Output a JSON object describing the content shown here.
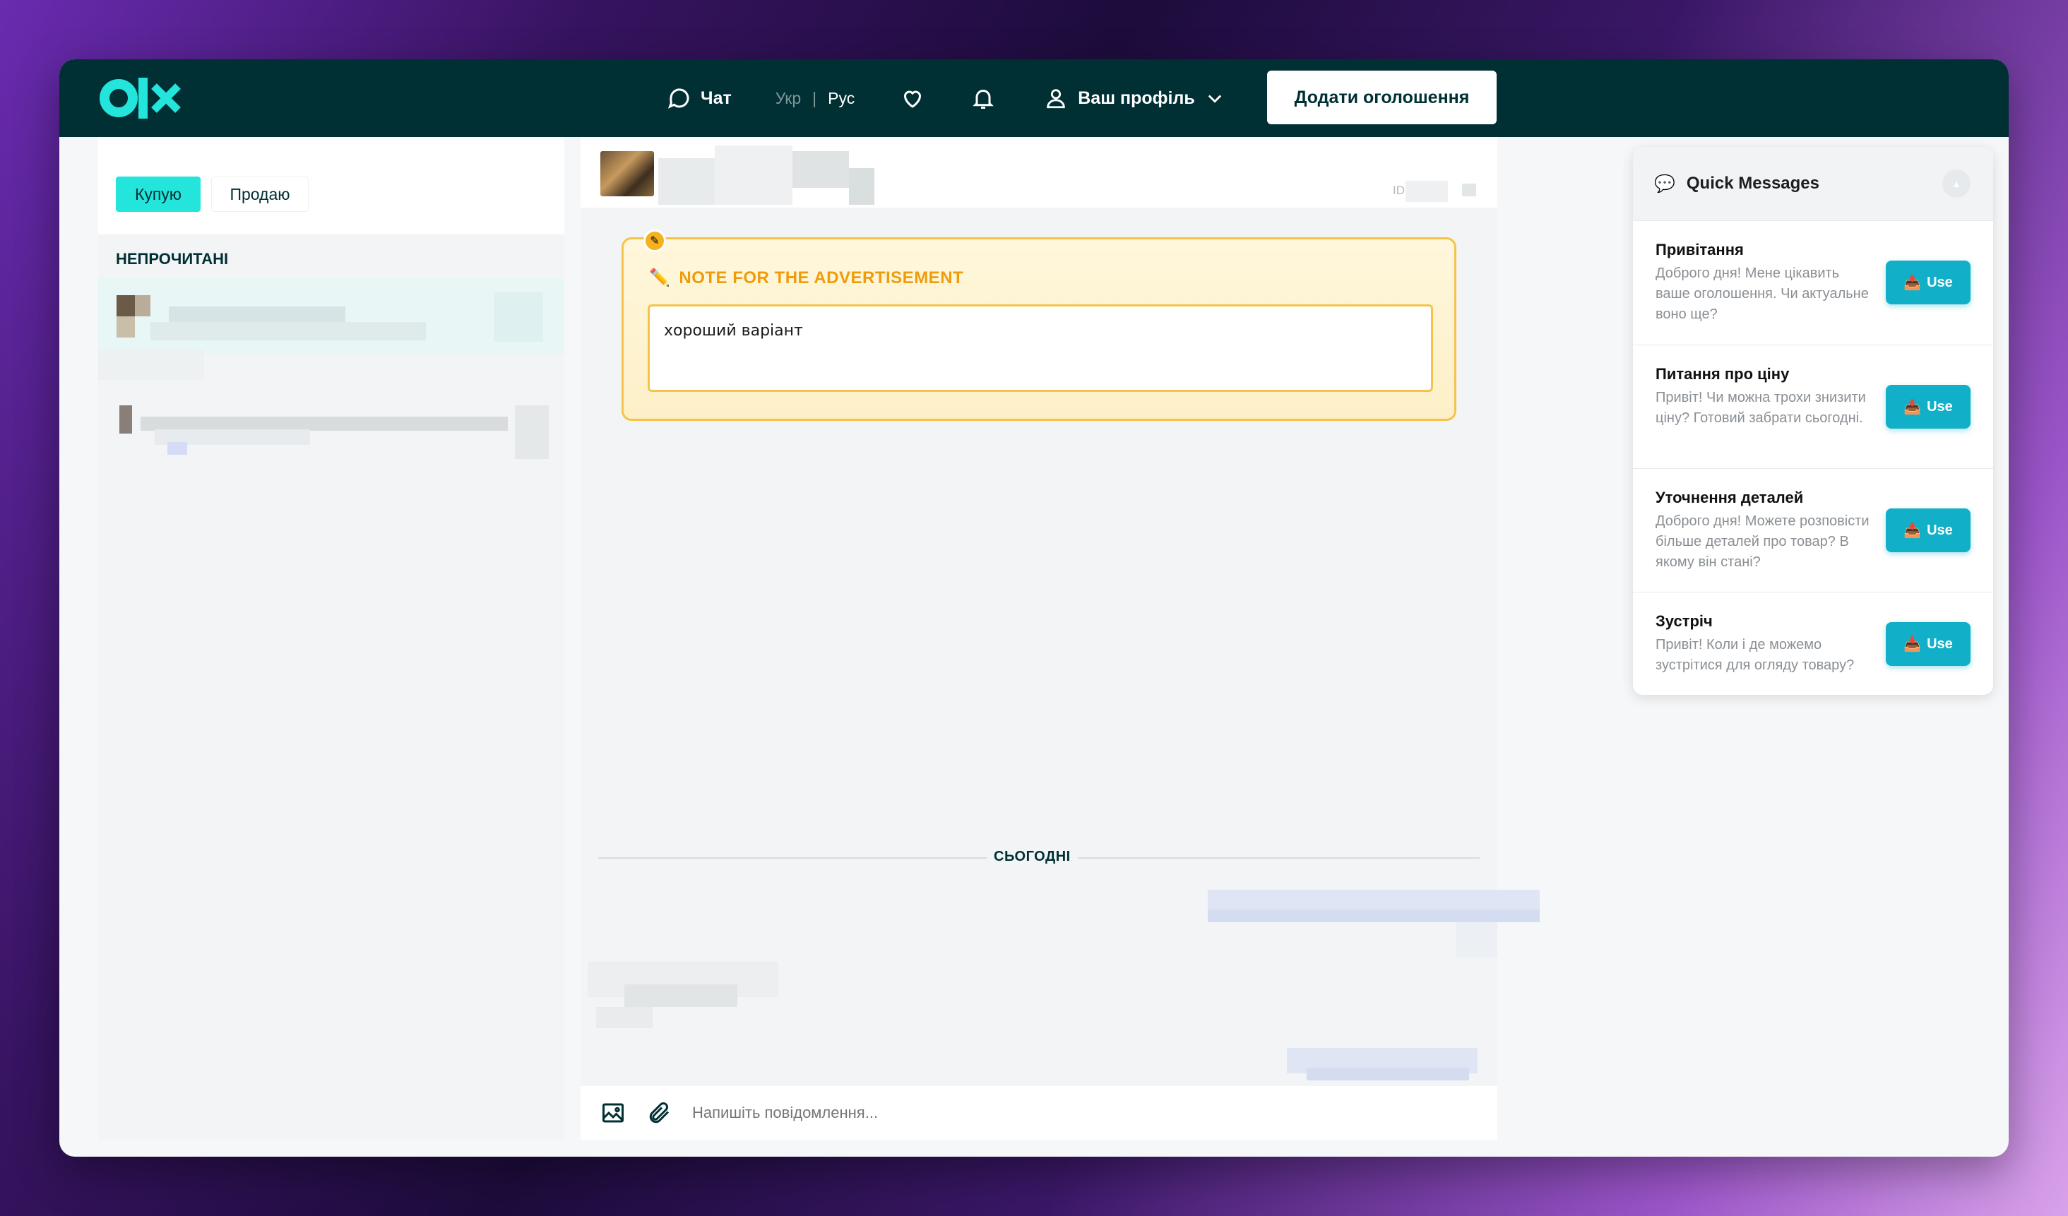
{
  "header": {
    "chat_label": "Чат",
    "lang_ukr": "Укр",
    "lang_sep": "|",
    "lang_rus": "Рус",
    "profile_label": "Ваш профіль",
    "add_button": "Додати оголошення"
  },
  "sidebar": {
    "tab_buy": "Купую",
    "tab_sell": "Продаю",
    "section_title": "НЕПРОЧИТАНІ"
  },
  "chat": {
    "id_label": "ID",
    "note_title": "NOTE FOR THE ADVERTISEMENT",
    "note_text": "хороший варіант",
    "day_label": "СЬОГОДНІ",
    "input_placeholder": "Напишіть повідомлення..."
  },
  "quick": {
    "title": "Quick Messages",
    "items": [
      {
        "title": "Привітання",
        "body": "Доброго дня! Мене цікавить ваше оголошення. Чи актуальне воно ще?",
        "button": "Use"
      },
      {
        "title": "Питання про ціну",
        "body": "Привіт! Чи можна трохи знизити ціну? Готовий забрати сьогодні.",
        "button": "Use"
      },
      {
        "title": "Уточнення деталей",
        "body": "Доброго дня! Можете розповісти більше деталей про товар? В якому він стані?",
        "button": "Use"
      },
      {
        "title": "Зустріч",
        "body": "Привіт! Коли і де можемо зустрітися для огляду товару?",
        "button": "Use"
      }
    ]
  },
  "colors": {
    "topbar": "#002f34",
    "accent": "#23e5db",
    "note_border": "#f6c34a",
    "note_title": "#f09c0a",
    "use_button": "#12b0c8"
  }
}
